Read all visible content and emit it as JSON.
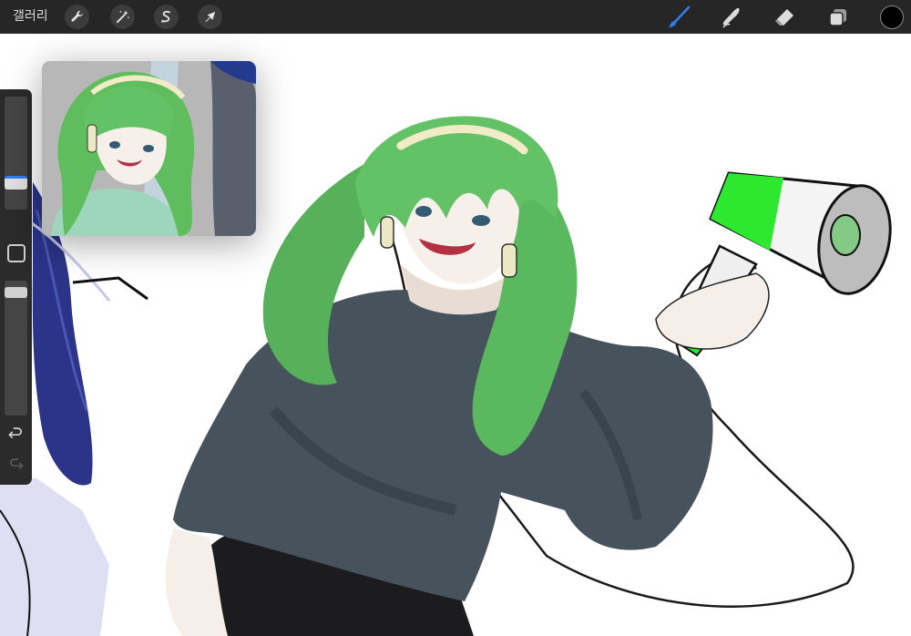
{
  "toolbar": {
    "gallery_label": "갤러리",
    "left_tools": [
      {
        "name": "actions",
        "icon": "wrench-icon"
      },
      {
        "name": "adjustments",
        "icon": "magic-wand-icon"
      },
      {
        "name": "selection",
        "icon": "selection-s-icon"
      },
      {
        "name": "transform",
        "icon": "arrow-cursor-icon"
      }
    ],
    "right_tools": [
      {
        "name": "brush",
        "icon": "brush-icon",
        "active": true
      },
      {
        "name": "smudge",
        "icon": "smudge-finger-icon",
        "active": false
      },
      {
        "name": "eraser",
        "icon": "eraser-icon",
        "active": false
      },
      {
        "name": "layers",
        "icon": "layers-icon",
        "active": false
      }
    ],
    "current_color": "#000000",
    "active_tool_color": "#2f7ff2"
  },
  "sidebar": {
    "brush_size_level": 0.78,
    "opacity_level": 0.05,
    "icons": [
      "square-modify-icon",
      "undo-icon",
      "redo-icon"
    ],
    "redo_enabled": false
  },
  "reference_window": {
    "visible": true
  }
}
